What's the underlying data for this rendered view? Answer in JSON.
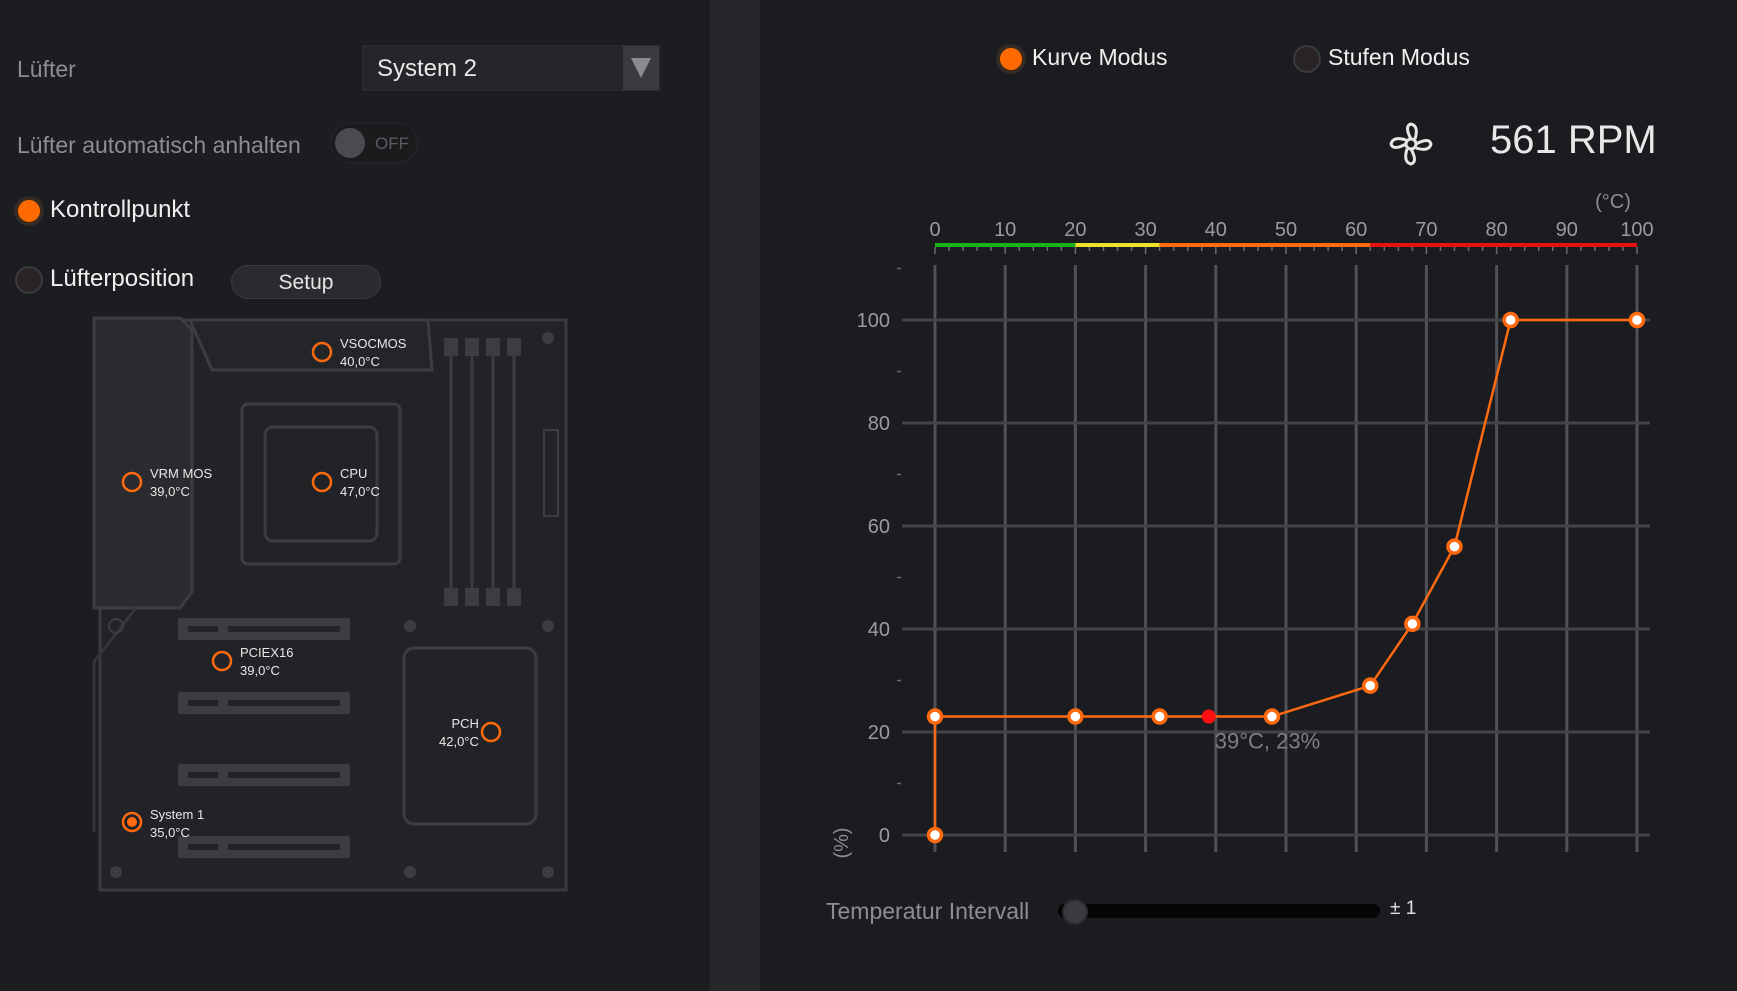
{
  "fan": {
    "label": "Lüfter",
    "selected": "System 2"
  },
  "auto_stop": {
    "label": "Lüfter automatisch anhalten",
    "state": "OFF"
  },
  "mode_left": {
    "control_point": "Kontrollpunkt",
    "fan_position": "Lüfterposition",
    "setup": "Setup"
  },
  "sensors": [
    {
      "name": "VSOCMOS",
      "temp": "40,0°C"
    },
    {
      "name": "VRM MOS",
      "temp": "39,0°C"
    },
    {
      "name": "CPU",
      "temp": "47,0°C"
    },
    {
      "name": "PCIEX16",
      "temp": "39,0°C"
    },
    {
      "name": "PCH",
      "temp": "42,0°C"
    },
    {
      "name": "System 1",
      "temp": "35,0°C"
    }
  ],
  "modes": {
    "curve": "Kurve Modus",
    "steps": "Stufen Modus"
  },
  "rpm": "561 RPM",
  "chart_data": {
    "type": "line",
    "x_unit": "(°C)",
    "y_unit": "(%)",
    "xlim": [
      0,
      100
    ],
    "ylim": [
      0,
      100
    ],
    "x_ticks": [
      "0",
      "10",
      "20",
      "30",
      "40",
      "50",
      "60",
      "70",
      "80",
      "90",
      "100"
    ],
    "y_ticks": [
      "0",
      "20",
      "40",
      "60",
      "80",
      "100"
    ],
    "points": [
      [
        0,
        0
      ],
      [
        0,
        23
      ],
      [
        20,
        23
      ],
      [
        32,
        23
      ],
      [
        48,
        23
      ],
      [
        62,
        29
      ],
      [
        68,
        41
      ],
      [
        74,
        56
      ],
      [
        82,
        100
      ],
      [
        100,
        100
      ]
    ],
    "current": {
      "x": 39,
      "y": 23,
      "label": "39°C, 23%"
    },
    "temp_scale_colors": [
      {
        "from": 0,
        "to": 20,
        "color": "#17b217"
      },
      {
        "from": 20,
        "to": 32,
        "color": "#f0e02a"
      },
      {
        "from": 32,
        "to": 62,
        "color": "#ff6a10"
      },
      {
        "from": 62,
        "to": 100,
        "color": "#e81010"
      }
    ],
    "accent": "#ff6a10"
  },
  "interval": {
    "label": "Temperatur Intervall",
    "value": "± 1"
  }
}
